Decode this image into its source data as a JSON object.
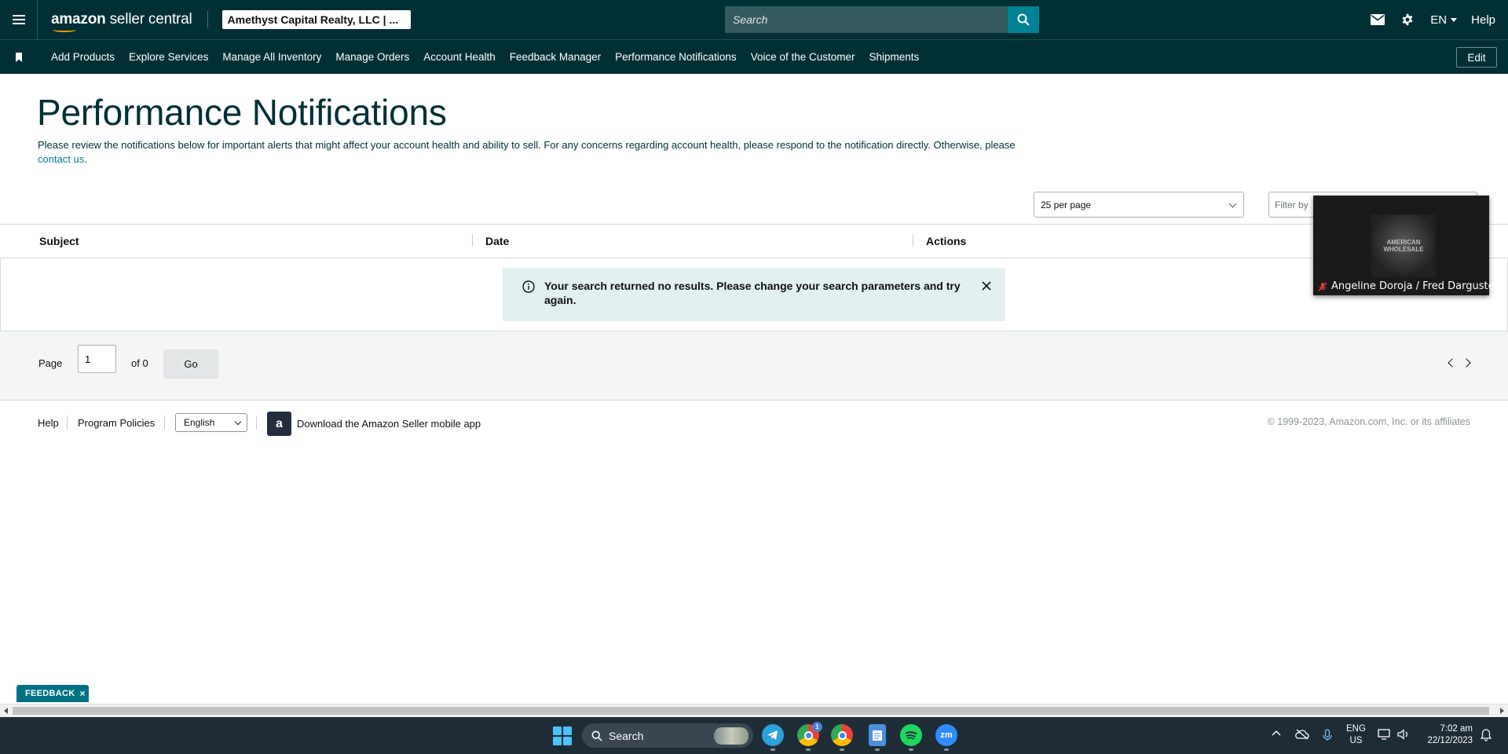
{
  "header": {
    "logo_amazon": "amazon",
    "logo_rest": " seller central",
    "account": "Amethyst Capital Realty, LLC | ...",
    "search_placeholder": "Search",
    "lang": "EN",
    "help": "Help",
    "icons": [
      "menu-icon",
      "mail-icon",
      "gear-icon",
      "search-icon"
    ]
  },
  "nav": {
    "items": [
      "Add Products",
      "Explore Services",
      "Manage All Inventory",
      "Manage Orders",
      "Account Health",
      "Feedback Manager",
      "Performance Notifications",
      "Voice of the Customer",
      "Shipments"
    ],
    "edit": "Edit"
  },
  "page": {
    "title": "Performance Notifications",
    "intro": "Please review the notifications below for important alerts that might affect your account health and ability to sell. For any concerns regarding account health, please respond to the notification directly. Otherwise, please ",
    "contact_link": "contact us",
    "intro_end": "."
  },
  "controls": {
    "per_page": "25 per page",
    "filter_placeholder": "Filter by"
  },
  "table": {
    "columns": [
      "Subject",
      "Date",
      "Actions"
    ],
    "alert": "Your search returned no results. Please change your search parameters and try again."
  },
  "pager": {
    "page_label": "Page",
    "page_value": "1",
    "of_label": "of 0",
    "go": "Go"
  },
  "footer": {
    "help": "Help",
    "policies": "Program Policies",
    "language": "English",
    "app_link": "Download the Amazon Seller mobile app",
    "copyright": "© 1999-2023, Amazon.com, Inc. or its affiliates"
  },
  "video": {
    "participant": "Angeline Doroja / Fred Darguste",
    "logo_text": "AMERICAN WHOLESALE"
  },
  "feedback": {
    "label": "FEEDBACK",
    "close": "×"
  },
  "taskbar": {
    "search": "Search",
    "lang_line1": "ENG",
    "lang_line2": "US",
    "time": "7:02 am",
    "date": "22/12/2023",
    "chrome_badge": "1",
    "zoom_label": "zm"
  },
  "colors": {
    "header_bg": "#002f36",
    "accent": "#008296",
    "alert_bg": "#e3f0f0"
  }
}
